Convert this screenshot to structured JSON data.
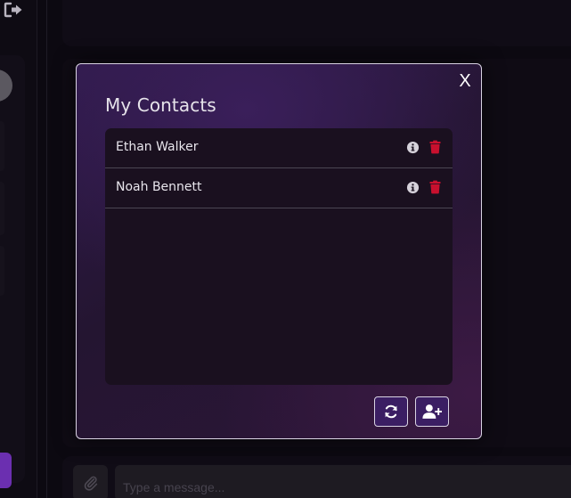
{
  "modal": {
    "title": "My Contacts",
    "close_label": "X",
    "contacts": [
      {
        "name": "Ethan Walker"
      },
      {
        "name": "Noah Bennett"
      }
    ],
    "refresh_icon": "refresh-icon",
    "add_contact_icon": "user-plus-icon"
  },
  "composer": {
    "placeholder": "Type a message...",
    "attach_icon": "paperclip-icon"
  },
  "rail": {
    "logout_icon": "logout-icon"
  },
  "colors": {
    "accent": "#3b1e63",
    "danger": "#c8102e",
    "modal_border": "#d9d3e3"
  }
}
